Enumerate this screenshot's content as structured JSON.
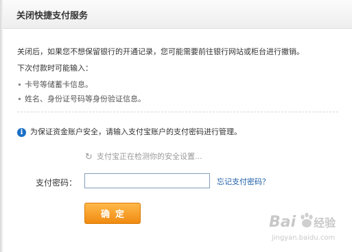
{
  "dialog": {
    "title": "关闭快捷支付服务"
  },
  "content": {
    "notice": "关闭后，如果您不想保留银行的开通记录，您可能需要前往银行网站或柜台进行撤销。",
    "next_time_label": "下次付款时可能输入：",
    "bullets": [
      "卡号等储蓄卡信息。",
      "姓名、身份证号码等身份验证信息。"
    ],
    "info_text": "为保证资金账户安全，请输入支付宝账户的支付密码进行管理。",
    "checking_text": "支付宝正在检测你的安全设置..."
  },
  "form": {
    "password_label": "支付密码：",
    "password_value": "",
    "forgot_link": "忘记支付密码？",
    "confirm_label": "确定"
  },
  "watermark": {
    "brand_left": "Bai",
    "brand_right": "经验",
    "url": "jingyan.baidu.com"
  },
  "colors": {
    "accent_orange": "#f08a10",
    "link_blue": "#1f5fa8",
    "info_blue": "#1a6fc4"
  }
}
